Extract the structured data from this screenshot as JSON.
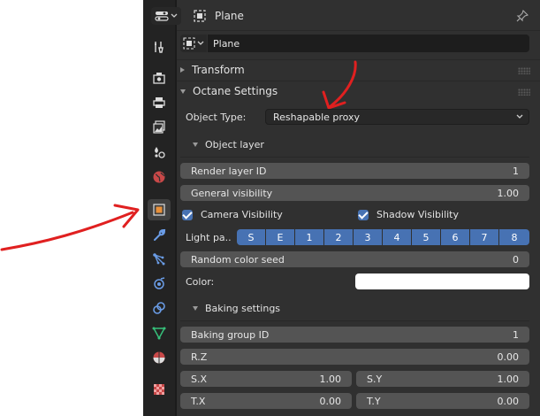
{
  "header": {
    "object_name": "Plane"
  },
  "datablock": {
    "name": "Plane"
  },
  "sections": {
    "transform": "Transform",
    "octane_settings": "Octane Settings"
  },
  "object_type": {
    "label": "Object Type:",
    "value": "Reshapable proxy"
  },
  "object_layer": {
    "title": "Object layer",
    "render_layer_id": {
      "label": "Render layer ID",
      "value": "1"
    },
    "general_visibility": {
      "label": "General visibility",
      "value": "1.00"
    },
    "camera_visibility": {
      "label": "Camera Visibility",
      "checked": true
    },
    "shadow_visibility": {
      "label": "Shadow Visibility",
      "checked": true
    },
    "light_pass": {
      "label": "Light pa..",
      "buttons": [
        "S",
        "E",
        "1",
        "2",
        "3",
        "4",
        "5",
        "6",
        "7",
        "8"
      ]
    },
    "random_color_seed": {
      "label": "Random color seed",
      "value": "0"
    },
    "color": {
      "label": "Color:",
      "value": "#ffffff"
    }
  },
  "baking": {
    "title": "Baking settings",
    "group_id": {
      "label": "Baking group ID",
      "value": "1"
    },
    "rz": {
      "label": "R.Z",
      "value": "0.00"
    },
    "sx": {
      "label": "S.X",
      "value": "1.00"
    },
    "sy": {
      "label": "S.Y",
      "value": "1.00"
    },
    "tx": {
      "label": "T.X",
      "value": "0.00"
    },
    "ty": {
      "label": "T.Y",
      "value": "0.00"
    }
  },
  "tabs": [
    "tool",
    "render",
    "output",
    "view-layer",
    "scene",
    "world",
    "object",
    "modifiers",
    "particles",
    "physics",
    "constraints",
    "object-data",
    "material",
    "texture"
  ],
  "colors": {
    "accent": "#4772b3",
    "annotation": "#e02020",
    "panel": "#303030",
    "field": "#545454"
  }
}
